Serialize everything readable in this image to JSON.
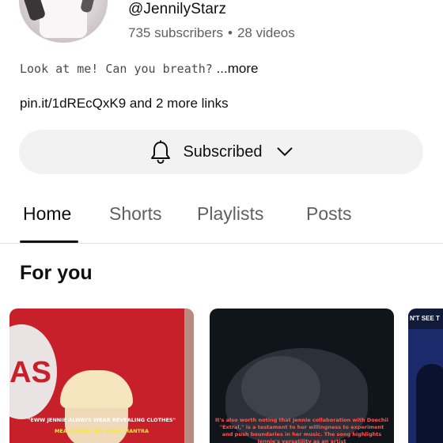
{
  "channel": {
    "handle": "@JennilyStarz",
    "subscribers": "735 subscribers",
    "separator": "•",
    "videos": "28 videos",
    "bio": "Look at me! Can you breath?",
    "bio_more": "...more",
    "links": "pin.it/1dREcQxK9 and 2 more links"
  },
  "subscribe_button": {
    "label": "Subscribed",
    "icon": "bell-icon",
    "chevron_icon": "chevron-down-icon"
  },
  "tabs": [
    {
      "label": "Home",
      "active": true
    },
    {
      "label": "Shorts",
      "active": false
    },
    {
      "label": "Playlists",
      "active": false
    },
    {
      "label": "Posts",
      "active": false
    }
  ],
  "section": {
    "title": "For you"
  },
  "thumbnails": [
    {
      "logo_text": "AS",
      "caption_line1": "\"EWW JENNIE ALWAYS WEAR REVEALING CLOTHES\"",
      "caption_line2": "MEANWHILE HER SONG MANTRA"
    },
    {
      "caption": "It's also worth noting that Jennie collaboration with Doechii \"Extral,\" is a testament to her willingness to experiment and push boundaries in her music. The song highlights Jennie's versatility as an artist"
    },
    {
      "caption": "N'T SEE T"
    }
  ]
}
